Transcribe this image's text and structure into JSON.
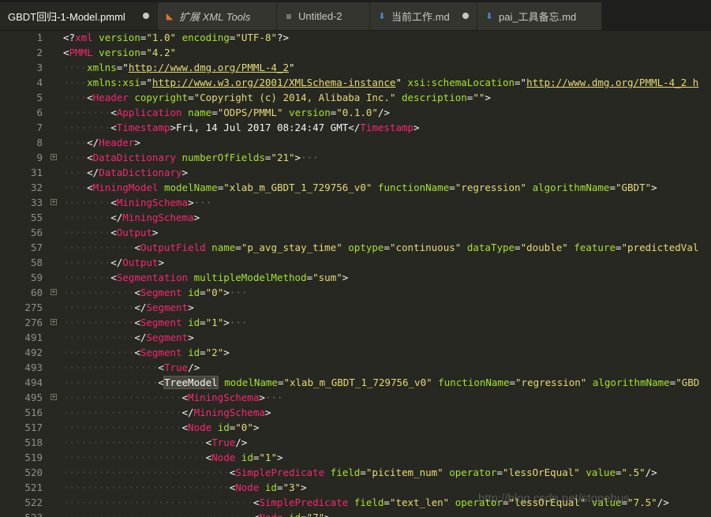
{
  "tabs": [
    {
      "label": "GBDT回归-1-Model.pmml",
      "icon": "none",
      "active": true,
      "dirty": true
    },
    {
      "label": "扩展 XML Tools",
      "icon": "rss-icon",
      "active": false,
      "dirty": false,
      "italic": true
    },
    {
      "label": "Untitled-2",
      "icon": "lines-icon",
      "active": false,
      "dirty": false
    },
    {
      "label": "当前工作.md",
      "icon": "markdown-icon",
      "active": false,
      "dirty": true
    },
    {
      "label": "pai_工具备忘.md",
      "icon": "markdown-icon",
      "active": false,
      "dirty": false
    }
  ],
  "lines": [
    {
      "n": "1",
      "indent": 0,
      "fold": false,
      "parts": [
        [
          "x",
          "<?"
        ],
        [
          "t",
          "xml"
        ],
        [
          "x",
          " "
        ],
        [
          "a",
          "version"
        ],
        [
          "x",
          "="
        ],
        [
          "s",
          "\"1.0\""
        ],
        [
          "x",
          " "
        ],
        [
          "a",
          "encoding"
        ],
        [
          "x",
          "="
        ],
        [
          "s",
          "\"UTF-8\""
        ],
        [
          "x",
          "?>"
        ]
      ]
    },
    {
      "n": "2",
      "indent": 0,
      "fold": false,
      "parts": [
        [
          "x",
          "<"
        ],
        [
          "t",
          "PMML"
        ],
        [
          "x",
          " "
        ],
        [
          "a",
          "version"
        ],
        [
          "x",
          "="
        ],
        [
          "s",
          "\"4.2\""
        ]
      ]
    },
    {
      "n": "3",
      "indent": 1,
      "fold": false,
      "parts": [
        [
          "a",
          "xmlns"
        ],
        [
          "x",
          "=\""
        ],
        [
          "u",
          "http://www.dmg.org/PMML-4_2"
        ],
        [
          "x",
          "\""
        ]
      ]
    },
    {
      "n": "4",
      "indent": 1,
      "fold": false,
      "parts": [
        [
          "a",
          "xmlns:xsi"
        ],
        [
          "x",
          "=\""
        ],
        [
          "u",
          "http://www.w3.org/2001/XMLSchema-instance"
        ],
        [
          "x",
          "\" "
        ],
        [
          "a",
          "xsi:schemaLocation"
        ],
        [
          "x",
          "=\""
        ],
        [
          "u",
          "http://www.dmg.org/PMML-4_2 h"
        ]
      ]
    },
    {
      "n": "5",
      "indent": 1,
      "fold": false,
      "parts": [
        [
          "x",
          "<"
        ],
        [
          "t",
          "Header"
        ],
        [
          "x",
          " "
        ],
        [
          "a",
          "copyright"
        ],
        [
          "x",
          "="
        ],
        [
          "s",
          "\"Copyright (c) 2014, Alibaba Inc.\""
        ],
        [
          "x",
          " "
        ],
        [
          "a",
          "description"
        ],
        [
          "x",
          "="
        ],
        [
          "s",
          "\"\""
        ],
        [
          "x",
          ">"
        ]
      ]
    },
    {
      "n": "6",
      "indent": 2,
      "fold": false,
      "parts": [
        [
          "x",
          "<"
        ],
        [
          "t",
          "Application"
        ],
        [
          "x",
          " "
        ],
        [
          "a",
          "name"
        ],
        [
          "x",
          "="
        ],
        [
          "s",
          "\"ODPS/PMML\""
        ],
        [
          "x",
          " "
        ],
        [
          "a",
          "version"
        ],
        [
          "x",
          "="
        ],
        [
          "s",
          "\"0.1.0\""
        ],
        [
          "x",
          "/>"
        ]
      ]
    },
    {
      "n": "7",
      "indent": 2,
      "fold": false,
      "parts": [
        [
          "x",
          "<"
        ],
        [
          "t",
          "Timestamp"
        ],
        [
          "x",
          ">Fri, 14 Jul 2017 08:24:47 GMT</"
        ],
        [
          "t",
          "Timestamp"
        ],
        [
          "x",
          ">"
        ]
      ]
    },
    {
      "n": "8",
      "indent": 1,
      "fold": false,
      "parts": [
        [
          "x",
          "</"
        ],
        [
          "t",
          "Header"
        ],
        [
          "x",
          ">"
        ]
      ]
    },
    {
      "n": "9",
      "indent": 1,
      "fold": true,
      "parts": [
        [
          "x",
          "<"
        ],
        [
          "t",
          "DataDictionary"
        ],
        [
          "x",
          " "
        ],
        [
          "a",
          "numberOfFields"
        ],
        [
          "x",
          "="
        ],
        [
          "s",
          "\"21\""
        ],
        [
          "x",
          ">"
        ],
        [
          "e",
          "···"
        ]
      ]
    },
    {
      "n": "31",
      "indent": 1,
      "fold": false,
      "parts": [
        [
          "x",
          "</"
        ],
        [
          "t",
          "DataDictionary"
        ],
        [
          "x",
          ">"
        ]
      ]
    },
    {
      "n": "32",
      "indent": 1,
      "fold": false,
      "parts": [
        [
          "x",
          "<"
        ],
        [
          "t",
          "MiningModel"
        ],
        [
          "x",
          " "
        ],
        [
          "a",
          "modelName"
        ],
        [
          "x",
          "="
        ],
        [
          "s",
          "\"xlab_m_GBDT_1_729756_v0\""
        ],
        [
          "x",
          " "
        ],
        [
          "a",
          "functionName"
        ],
        [
          "x",
          "="
        ],
        [
          "s",
          "\"regression\""
        ],
        [
          "x",
          " "
        ],
        [
          "a",
          "algorithmName"
        ],
        [
          "x",
          "="
        ],
        [
          "s",
          "\"GBDT\""
        ],
        [
          "x",
          ">"
        ]
      ]
    },
    {
      "n": "33",
      "indent": 2,
      "fold": true,
      "parts": [
        [
          "x",
          "<"
        ],
        [
          "t",
          "MiningSchema"
        ],
        [
          "x",
          ">"
        ],
        [
          "e",
          "···"
        ]
      ]
    },
    {
      "n": "55",
      "indent": 2,
      "fold": false,
      "parts": [
        [
          "x",
          "</"
        ],
        [
          "t",
          "MiningSchema"
        ],
        [
          "x",
          ">"
        ]
      ]
    },
    {
      "n": "56",
      "indent": 2,
      "fold": false,
      "parts": [
        [
          "x",
          "<"
        ],
        [
          "t",
          "Output"
        ],
        [
          "x",
          ">"
        ]
      ]
    },
    {
      "n": "57",
      "indent": 3,
      "fold": false,
      "parts": [
        [
          "x",
          "<"
        ],
        [
          "t",
          "OutputField"
        ],
        [
          "x",
          " "
        ],
        [
          "a",
          "name"
        ],
        [
          "x",
          "="
        ],
        [
          "s",
          "\"p_avg_stay_time\""
        ],
        [
          "x",
          " "
        ],
        [
          "a",
          "optype"
        ],
        [
          "x",
          "="
        ],
        [
          "s",
          "\"continuous\""
        ],
        [
          "x",
          " "
        ],
        [
          "a",
          "dataType"
        ],
        [
          "x",
          "="
        ],
        [
          "s",
          "\"double\""
        ],
        [
          "x",
          " "
        ],
        [
          "a",
          "feature"
        ],
        [
          "x",
          "="
        ],
        [
          "s",
          "\"predictedVal"
        ]
      ]
    },
    {
      "n": "58",
      "indent": 2,
      "fold": false,
      "parts": [
        [
          "x",
          "</"
        ],
        [
          "t",
          "Output"
        ],
        [
          "x",
          ">"
        ]
      ]
    },
    {
      "n": "59",
      "indent": 2,
      "fold": false,
      "parts": [
        [
          "x",
          "<"
        ],
        [
          "t",
          "Segmentation"
        ],
        [
          "x",
          " "
        ],
        [
          "a",
          "multipleModelMethod"
        ],
        [
          "x",
          "="
        ],
        [
          "s",
          "\"sum\""
        ],
        [
          "x",
          ">"
        ]
      ]
    },
    {
      "n": "60",
      "indent": 3,
      "fold": true,
      "parts": [
        [
          "x",
          "<"
        ],
        [
          "t",
          "Segment"
        ],
        [
          "x",
          " "
        ],
        [
          "a",
          "id"
        ],
        [
          "x",
          "="
        ],
        [
          "s",
          "\"0\""
        ],
        [
          "x",
          ">"
        ],
        [
          "e",
          "···"
        ]
      ]
    },
    {
      "n": "275",
      "indent": 3,
      "fold": false,
      "parts": [
        [
          "x",
          "</"
        ],
        [
          "t",
          "Segment"
        ],
        [
          "x",
          ">"
        ]
      ]
    },
    {
      "n": "276",
      "indent": 3,
      "fold": true,
      "parts": [
        [
          "x",
          "<"
        ],
        [
          "t",
          "Segment"
        ],
        [
          "x",
          " "
        ],
        [
          "a",
          "id"
        ],
        [
          "x",
          "="
        ],
        [
          "s",
          "\"1\""
        ],
        [
          "x",
          ">"
        ],
        [
          "e",
          "···"
        ]
      ]
    },
    {
      "n": "491",
      "indent": 3,
      "fold": false,
      "parts": [
        [
          "x",
          "</"
        ],
        [
          "t",
          "Segment"
        ],
        [
          "x",
          ">"
        ]
      ]
    },
    {
      "n": "492",
      "indent": 3,
      "fold": false,
      "parts": [
        [
          "x",
          "<"
        ],
        [
          "t",
          "Segment"
        ],
        [
          "x",
          " "
        ],
        [
          "a",
          "id"
        ],
        [
          "x",
          "="
        ],
        [
          "s",
          "\"2\""
        ],
        [
          "x",
          ">"
        ]
      ]
    },
    {
      "n": "493",
      "indent": 4,
      "fold": false,
      "parts": [
        [
          "x",
          "<"
        ],
        [
          "t",
          "True"
        ],
        [
          "x",
          "/>"
        ]
      ]
    },
    {
      "n": "494",
      "indent": 4,
      "fold": false,
      "parts": [
        [
          "x",
          "<"
        ],
        [
          "hl",
          "TreeModel"
        ],
        [
          "cur",
          ""
        ],
        [
          "x",
          " "
        ],
        [
          "a",
          "modelName"
        ],
        [
          "x",
          "="
        ],
        [
          "s",
          "\"xlab_m_GBDT_1_729756_v0\""
        ],
        [
          "x",
          " "
        ],
        [
          "a",
          "functionName"
        ],
        [
          "x",
          "="
        ],
        [
          "s",
          "\"regression\""
        ],
        [
          "x",
          " "
        ],
        [
          "a",
          "algorithmName"
        ],
        [
          "x",
          "="
        ],
        [
          "s",
          "\"GBD"
        ]
      ]
    },
    {
      "n": "495",
      "indent": 5,
      "fold": true,
      "parts": [
        [
          "x",
          "<"
        ],
        [
          "t",
          "MiningSchema"
        ],
        [
          "x",
          ">"
        ],
        [
          "e",
          "···"
        ]
      ]
    },
    {
      "n": "516",
      "indent": 5,
      "fold": false,
      "parts": [
        [
          "x",
          "</"
        ],
        [
          "t",
          "MiningSchema"
        ],
        [
          "x",
          ">"
        ]
      ]
    },
    {
      "n": "517",
      "indent": 5,
      "fold": false,
      "parts": [
        [
          "x",
          "<"
        ],
        [
          "t",
          "Node"
        ],
        [
          "x",
          " "
        ],
        [
          "a",
          "id"
        ],
        [
          "x",
          "="
        ],
        [
          "s",
          "\"0\""
        ],
        [
          "x",
          ">"
        ]
      ]
    },
    {
      "n": "518",
      "indent": 6,
      "fold": false,
      "parts": [
        [
          "x",
          "<"
        ],
        [
          "t",
          "True"
        ],
        [
          "x",
          "/>"
        ]
      ]
    },
    {
      "n": "519",
      "indent": 6,
      "fold": false,
      "parts": [
        [
          "x",
          "<"
        ],
        [
          "t",
          "Node"
        ],
        [
          "x",
          " "
        ],
        [
          "a",
          "id"
        ],
        [
          "x",
          "="
        ],
        [
          "s",
          "\"1\""
        ],
        [
          "x",
          ">"
        ]
      ]
    },
    {
      "n": "520",
      "indent": 7,
      "fold": false,
      "parts": [
        [
          "x",
          "<"
        ],
        [
          "t",
          "SimplePredicate"
        ],
        [
          "x",
          " "
        ],
        [
          "a",
          "field"
        ],
        [
          "x",
          "="
        ],
        [
          "s",
          "\"picitem_num\""
        ],
        [
          "x",
          " "
        ],
        [
          "a",
          "operator"
        ],
        [
          "x",
          "="
        ],
        [
          "s",
          "\"lessOrEqual\""
        ],
        [
          "x",
          " "
        ],
        [
          "a",
          "value"
        ],
        [
          "x",
          "="
        ],
        [
          "s",
          "\".5\""
        ],
        [
          "x",
          "/>"
        ]
      ]
    },
    {
      "n": "521",
      "indent": 7,
      "fold": false,
      "parts": [
        [
          "x",
          "<"
        ],
        [
          "t",
          "Node"
        ],
        [
          "x",
          " "
        ],
        [
          "a",
          "id"
        ],
        [
          "x",
          "="
        ],
        [
          "s",
          "\"3\""
        ],
        [
          "x",
          ">"
        ]
      ]
    },
    {
      "n": "522",
      "indent": 8,
      "fold": false,
      "parts": [
        [
          "x",
          "<"
        ],
        [
          "t",
          "SimplePredicate"
        ],
        [
          "x",
          " "
        ],
        [
          "a",
          "field"
        ],
        [
          "x",
          "="
        ],
        [
          "s",
          "\"text_len\""
        ],
        [
          "x",
          " "
        ],
        [
          "a",
          "operator"
        ],
        [
          "x",
          "="
        ],
        [
          "s",
          "\"lessOrEqual\""
        ],
        [
          "x",
          " "
        ],
        [
          "a",
          "value"
        ],
        [
          "x",
          "="
        ],
        [
          "s",
          "\"7.5\""
        ],
        [
          "x",
          "/>"
        ]
      ]
    },
    {
      "n": "523",
      "indent": 8,
      "fold": false,
      "parts": [
        [
          "x",
          "<"
        ],
        [
          "t",
          "Node"
        ],
        [
          "x",
          " "
        ],
        [
          "a",
          "id"
        ],
        [
          "x",
          "="
        ],
        [
          "s",
          "\"7\""
        ],
        [
          "x",
          ">"
        ]
      ]
    }
  ],
  "watermark": "http://blog.csdn.net/stonehus"
}
